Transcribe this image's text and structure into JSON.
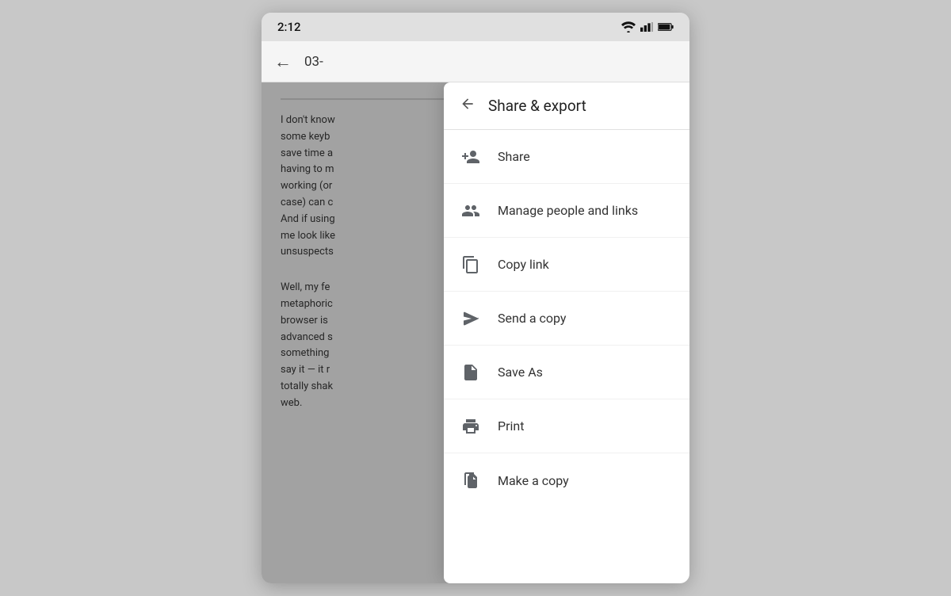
{
  "statusBar": {
    "time": "2:12"
  },
  "appBar": {
    "backLabel": "←",
    "title": "03-"
  },
  "docContent": {
    "paragraph1": "I don't know\nsome keyb\nsave time a\nhaving to m\nworking (or\ncase) can c\nAnd if using\nme look like\nunsuspects",
    "paragraph2": "Well, my fe\nmetaphoric\nbrowser is\nadvanced s\nsomething\nsay it — it r\ntotally shak\nweb."
  },
  "menu": {
    "headerBackLabel": "←",
    "headerTitle": "Share & export",
    "items": [
      {
        "id": "share",
        "label": "Share",
        "icon": "share-person-icon"
      },
      {
        "id": "manage-people",
        "label": "Manage people and links",
        "icon": "manage-people-icon"
      },
      {
        "id": "copy-link",
        "label": "Copy link",
        "icon": "copy-link-icon"
      },
      {
        "id": "send-copy",
        "label": "Send a copy",
        "icon": "send-copy-icon"
      },
      {
        "id": "save-as",
        "label": "Save As",
        "icon": "save-as-icon"
      },
      {
        "id": "print",
        "label": "Print",
        "icon": "print-icon"
      },
      {
        "id": "make-copy",
        "label": "Make a copy",
        "icon": "make-copy-icon"
      }
    ]
  }
}
